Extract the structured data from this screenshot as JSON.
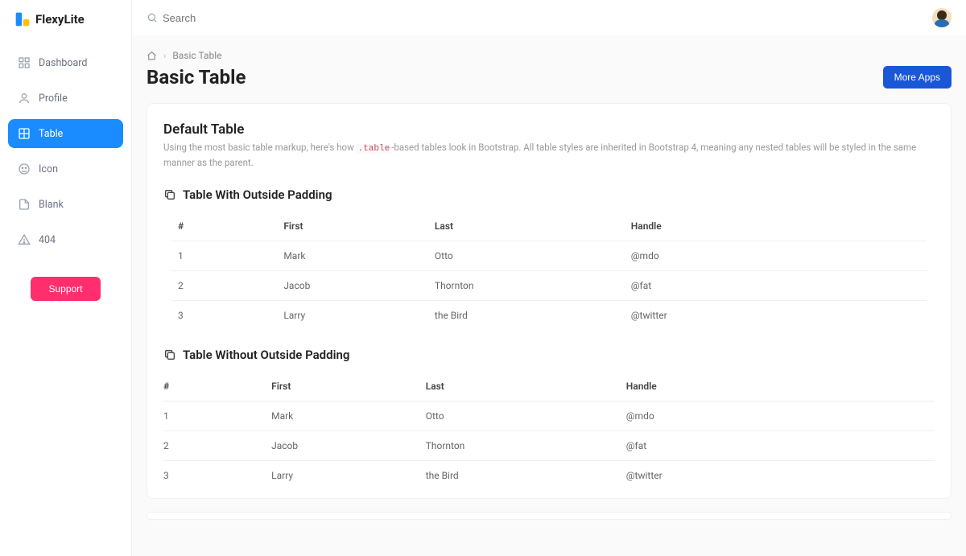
{
  "brand": {
    "name": "FlexyLite"
  },
  "search": {
    "placeholder": "Search"
  },
  "sidebar": {
    "items": [
      {
        "label": "Dashboard",
        "icon": "dashboard-icon"
      },
      {
        "label": "Profile",
        "icon": "profile-icon"
      },
      {
        "label": "Table",
        "icon": "table-icon",
        "active": true
      },
      {
        "label": "Icon",
        "icon": "face-icon"
      },
      {
        "label": "Blank",
        "icon": "file-icon"
      },
      {
        "label": "404",
        "icon": "warning-icon"
      }
    ],
    "support_label": "Support"
  },
  "breadcrumb": {
    "current": "Basic Table"
  },
  "page": {
    "title": "Basic Table",
    "more_apps_label": "More Apps"
  },
  "card": {
    "title": "Default Table",
    "desc_pre": "Using the most basic table markup, here's how ",
    "desc_code": ".table",
    "desc_post": "-based tables look in Bootstrap. All table styles are inherited in Bootstrap 4, meaning any nested tables will be styled in the same manner as the parent.",
    "tables": [
      {
        "subtitle": "Table With Outside Padding",
        "headers": [
          "#",
          "First",
          "Last",
          "Handle"
        ],
        "rows": [
          [
            "1",
            "Mark",
            "Otto",
            "@mdo"
          ],
          [
            "2",
            "Jacob",
            "Thornton",
            "@fat"
          ],
          [
            "3",
            "Larry",
            "the Bird",
            "@twitter"
          ]
        ]
      },
      {
        "subtitle": "Table Without Outside Padding",
        "headers": [
          "#",
          "First",
          "Last",
          "Handle"
        ],
        "rows": [
          [
            "1",
            "Mark",
            "Otto",
            "@mdo"
          ],
          [
            "2",
            "Jacob",
            "Thornton",
            "@fat"
          ],
          [
            "3",
            "Larry",
            "the Bird",
            "@twitter"
          ]
        ]
      }
    ]
  },
  "colors": {
    "primary": "#1a8cff",
    "accent": "#ff2f6e",
    "button_blue": "#1a57d6"
  }
}
